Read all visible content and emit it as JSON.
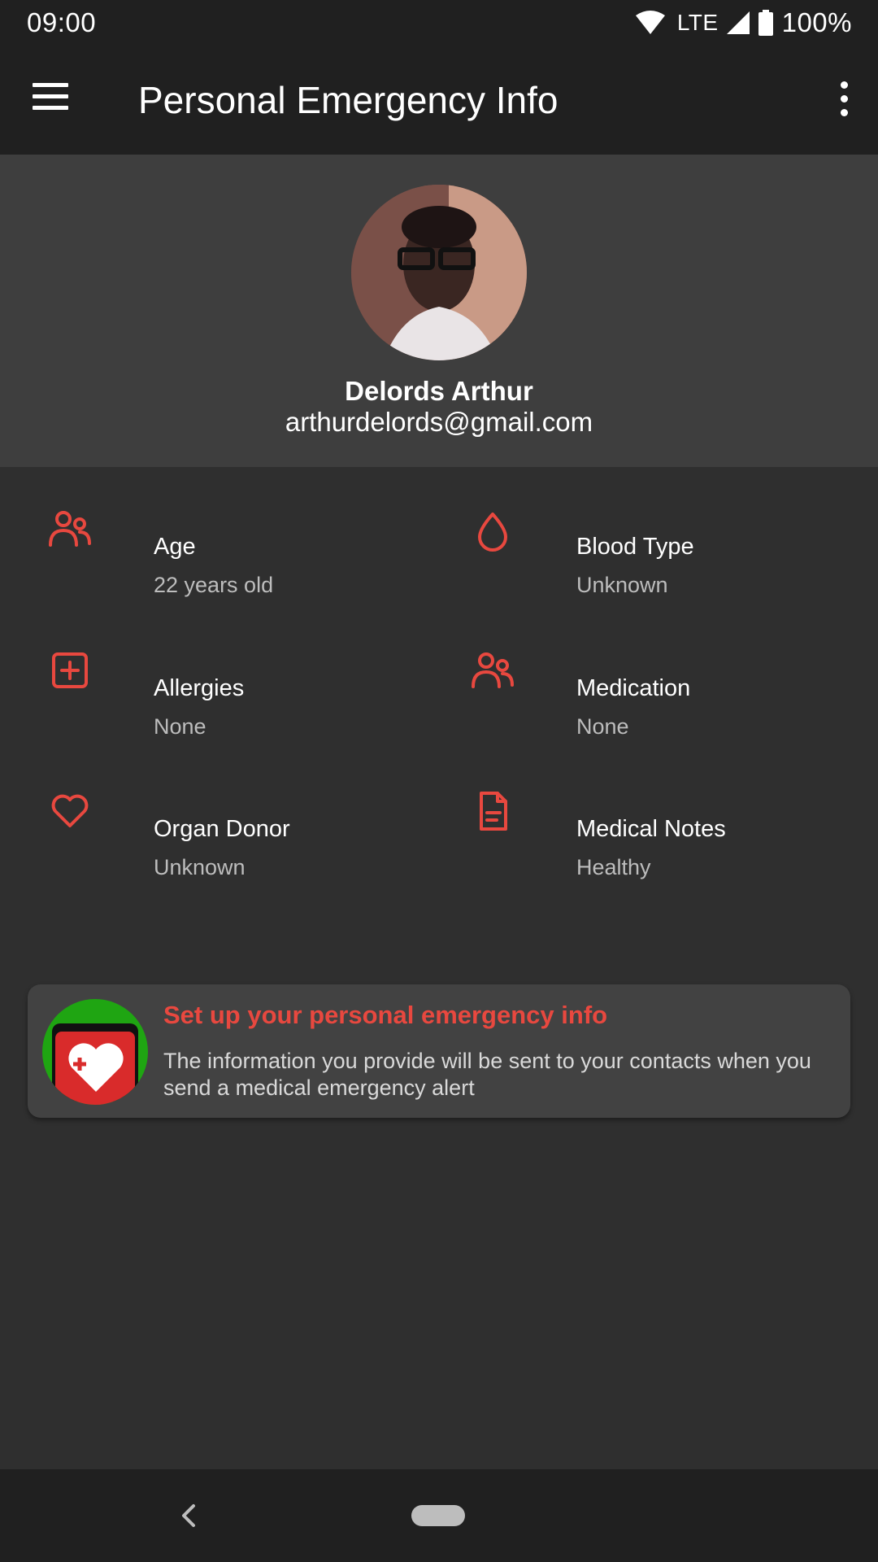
{
  "status_bar": {
    "time": "09:00",
    "network": "LTE",
    "battery": "100%"
  },
  "app_bar": {
    "title": "Personal Emergency Info"
  },
  "profile": {
    "name": "Delords Arthur",
    "email": "arthurdelords@gmail.com"
  },
  "info_items": [
    {
      "label": "Age",
      "value": "22 years old",
      "icon": "people-icon"
    },
    {
      "label": "Blood Type",
      "value": "Unknown",
      "icon": "blood-drop-icon"
    },
    {
      "label": "Allergies",
      "value": "None",
      "icon": "medical-plus-icon"
    },
    {
      "label": "Medication",
      "value": "None",
      "icon": "people-icon"
    },
    {
      "label": "Organ Donor",
      "value": "Unknown",
      "icon": "heart-icon"
    },
    {
      "label": "Medical Notes",
      "value": "Healthy",
      "icon": "document-icon"
    }
  ],
  "setup_card": {
    "title": "Set up your personal emergency info",
    "description": "The information you provide will be sent to your contacts when you send a medical emergency alert"
  },
  "colors": {
    "accent": "#e8483f",
    "background": "#2f2f2f",
    "bar": "#202020",
    "profile_bg": "#3e3e3e",
    "card_icon_bg": "#1fa512"
  }
}
